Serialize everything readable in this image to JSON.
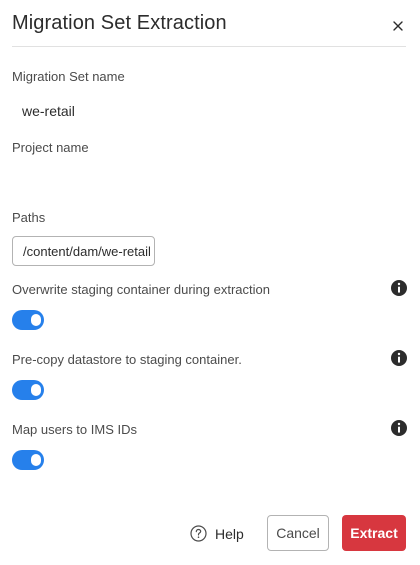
{
  "dialog": {
    "title": "Migration Set Extraction",
    "close_icon": "close-icon"
  },
  "fields": {
    "migration_set_label": "Migration Set name",
    "migration_set_value": "we-retail",
    "project_label": "Project name",
    "project_value": "",
    "paths_label": "Paths",
    "paths_value": "/content/dam/we-retail"
  },
  "toggles": [
    {
      "label": "Overwrite staging container during extraction",
      "checked": true,
      "icon": "info-icon"
    },
    {
      "label": "Pre-copy datastore to staging container.",
      "checked": true,
      "icon": "info-icon"
    },
    {
      "label": "Map users to IMS IDs",
      "checked": true,
      "icon": "info-icon"
    }
  ],
  "footer": {
    "help_label": "Help",
    "help_icon": "help-circle-icon",
    "cancel_label": "Cancel",
    "extract_label": "Extract"
  },
  "colors": {
    "toggle_on": "#2680eb",
    "primary_action": "#d7373f"
  }
}
